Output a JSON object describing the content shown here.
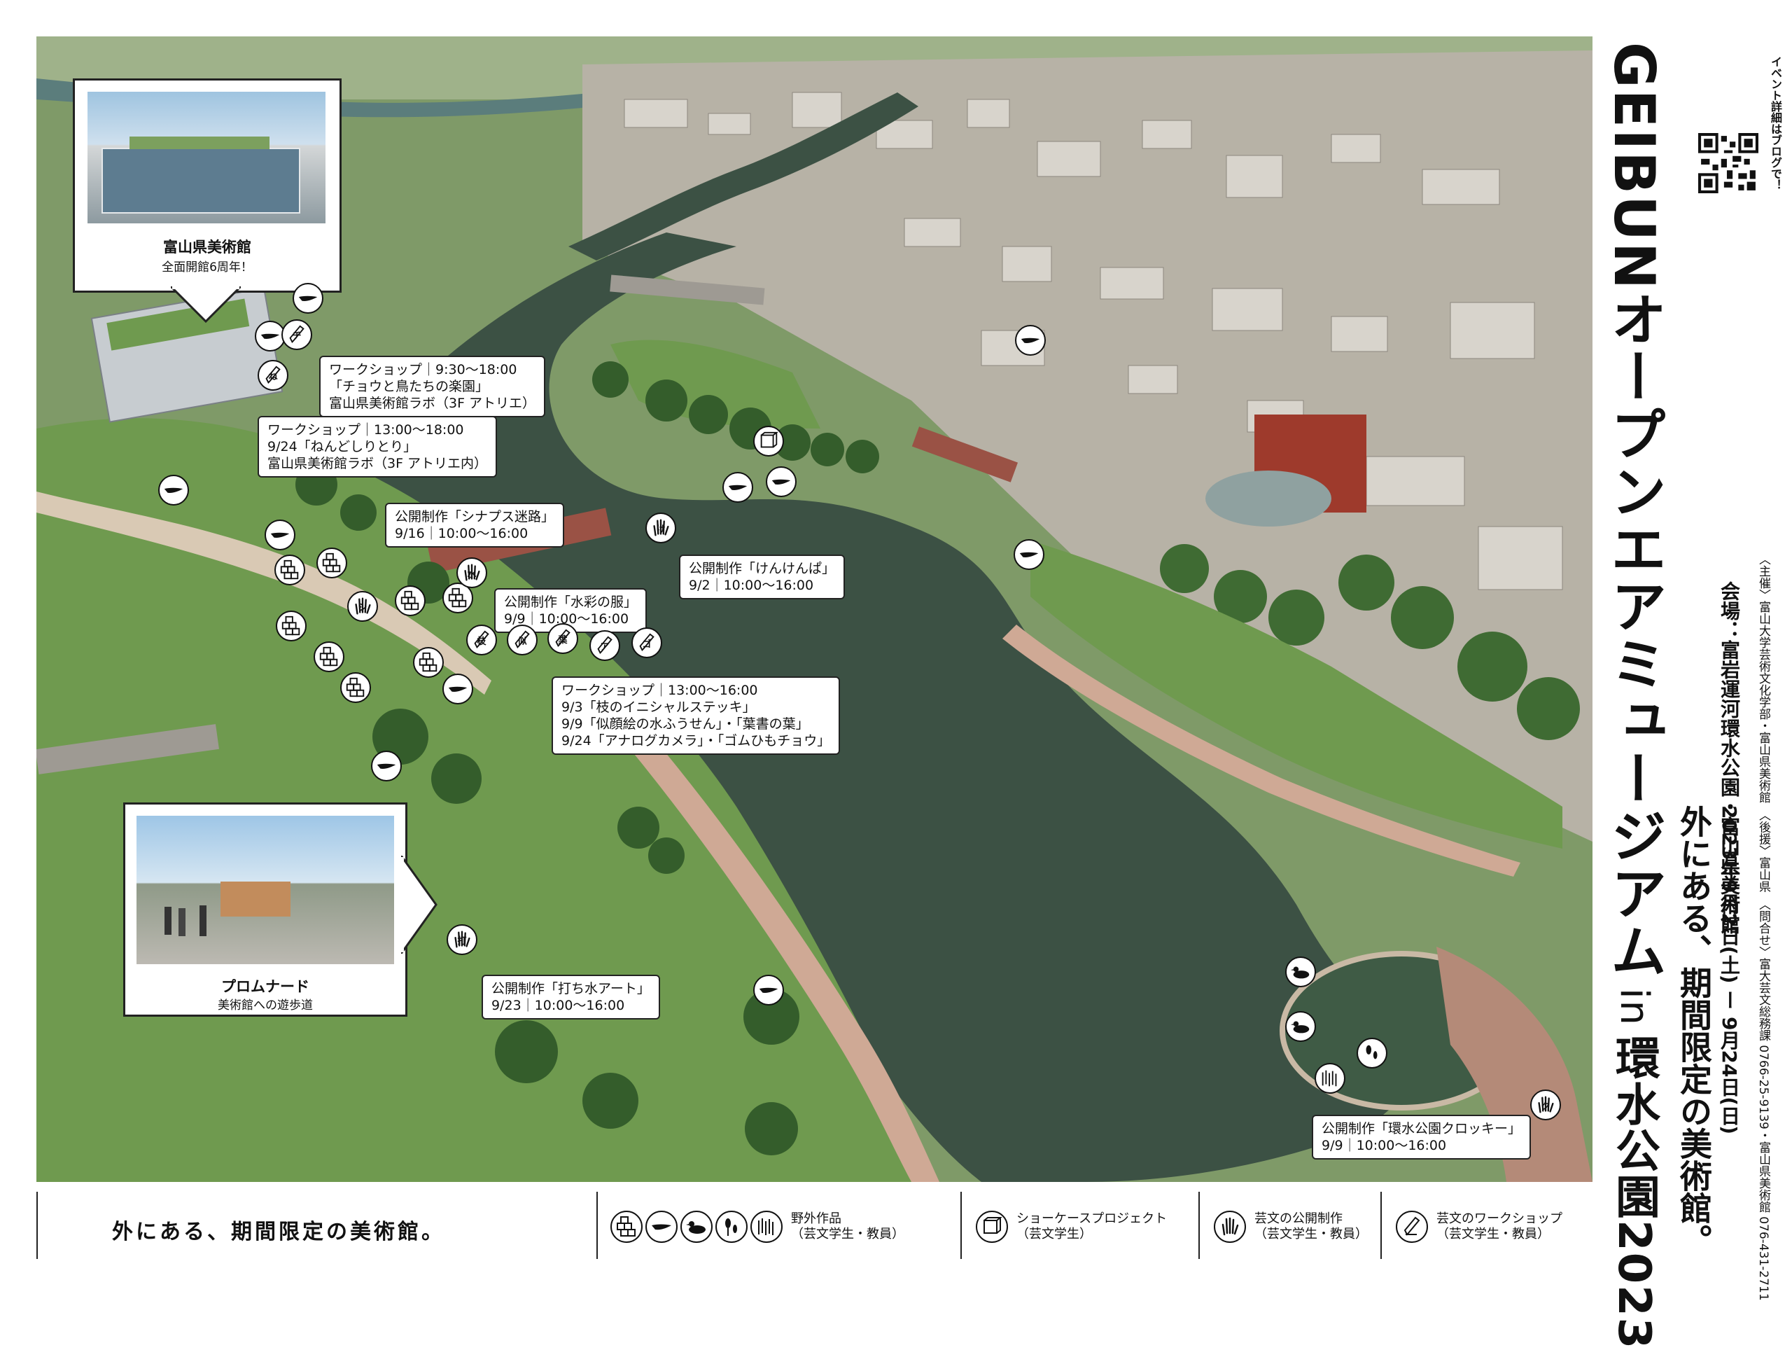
{
  "title": {
    "brand": "GEIBUN",
    "main": "オープンエアミュージアム",
    "in": "in",
    "place_year": "環水公園2023",
    "qr_caption": "イベント詳細はブログで！",
    "tagline": "外にある、期間限定の美術館。",
    "dates": "2023年9月2日(土) ー 9月24日(日)",
    "venue": "会場：富岩運河環水公園・富山県美術館",
    "host": "〈主催〉富山大学芸術文化学部・富山県美術館　〈後援〉富山県　〈問合せ〉富大芸文総務課 0766-25-9139・富山県美術館 076-431-2711"
  },
  "insets": [
    {
      "id": "museum",
      "caption": "富山県美術館",
      "subcaption": "全面開館6周年！"
    },
    {
      "id": "promenade",
      "caption": "プロムナード",
      "subcaption": "美術館への遊歩道"
    }
  ],
  "callouts": [
    {
      "id": "ws1",
      "lines": [
        "ワークショップ｜9:30〜18:00",
        "「チョウと鳥たちの楽園」",
        "富山県美術館ラボ（3F アトリエ）"
      ]
    },
    {
      "id": "ws2",
      "lines": [
        "ワークショップ｜13:00〜18:00",
        "9/24「ねんどしりとり」",
        "富山県美術館ラボ（3F アトリエ内）"
      ]
    },
    {
      "id": "pub_synapse",
      "lines": [
        "公開制作「シナプス迷路」",
        "9/16｜10:00〜16:00"
      ]
    },
    {
      "id": "pub_kenken",
      "lines": [
        "公開制作「けんけんぱ」",
        "9/2｜10:00〜16:00"
      ]
    },
    {
      "id": "pub_suisai",
      "lines": [
        "公開制作「水彩の服」",
        "9/9｜10:00〜16:00"
      ]
    },
    {
      "id": "ws3",
      "lines": [
        "ワークショップ｜13:00〜16:00",
        "9/3「枝のイニシャルステッキ」",
        "9/9「似顔絵の水ふうせん」・「葉書の葉」",
        "9/24「アナログカメラ」・「ゴムひもチョウ」"
      ]
    },
    {
      "id": "pub_uchimizu",
      "lines": [
        "公開制作「打ち水アート」",
        "9/23｜10:00〜16:00"
      ]
    },
    {
      "id": "pub_croquis",
      "lines": [
        "公開制作「環水公園クロッキー」",
        "9/9｜10:00〜16:00"
      ]
    }
  ],
  "markers": [
    {
      "kind": "bird",
      "label": ""
    },
    {
      "kind": "bird",
      "label": ""
    },
    {
      "kind": "pencil",
      "label": "チ"
    },
    {
      "kind": "pencil",
      "label": "ね"
    },
    {
      "kind": "bird",
      "label": ""
    },
    {
      "kind": "bird",
      "label": ""
    },
    {
      "kind": "blocks",
      "label": ""
    },
    {
      "kind": "blocks",
      "label": ""
    },
    {
      "kind": "blocks",
      "label": ""
    },
    {
      "kind": "blocks",
      "label": ""
    },
    {
      "kind": "hand",
      "label": "シ"
    },
    {
      "kind": "blocks",
      "label": ""
    },
    {
      "kind": "blocks",
      "label": ""
    },
    {
      "kind": "blocks",
      "label": ""
    },
    {
      "kind": "blocks",
      "label": ""
    },
    {
      "kind": "hand",
      "label": "水"
    },
    {
      "kind": "pencil",
      "label": "枝"
    },
    {
      "kind": "pencil",
      "label": "似"
    },
    {
      "kind": "pencil",
      "label": "葉"
    },
    {
      "kind": "pencil",
      "label": "ア"
    },
    {
      "kind": "pencil",
      "label": "ゴ"
    },
    {
      "kind": "bird",
      "label": ""
    },
    {
      "kind": "showcase",
      "label": ""
    },
    {
      "kind": "bird",
      "label": ""
    },
    {
      "kind": "bird",
      "label": ""
    },
    {
      "kind": "hand",
      "label": "け"
    },
    {
      "kind": "bird",
      "label": ""
    },
    {
      "kind": "bird",
      "label": ""
    },
    {
      "kind": "bird",
      "label": ""
    },
    {
      "kind": "hand",
      "label": "打"
    },
    {
      "kind": "bird",
      "label": ""
    },
    {
      "kind": "duck",
      "label": ""
    },
    {
      "kind": "duck",
      "label": ""
    },
    {
      "kind": "drops",
      "label": ""
    },
    {
      "kind": "figures",
      "label": ""
    },
    {
      "kind": "hand",
      "label": "ク"
    }
  ],
  "legend": {
    "outdoor": "野外作品\n（芸文学生・教員）",
    "showcase": "ショーケースプロジェクト\n（芸文学生）",
    "public": "芸文の公開制作\n（芸文学生・教員）",
    "workshop": "芸文のワークショップ\n（芸文学生・教員）"
  }
}
